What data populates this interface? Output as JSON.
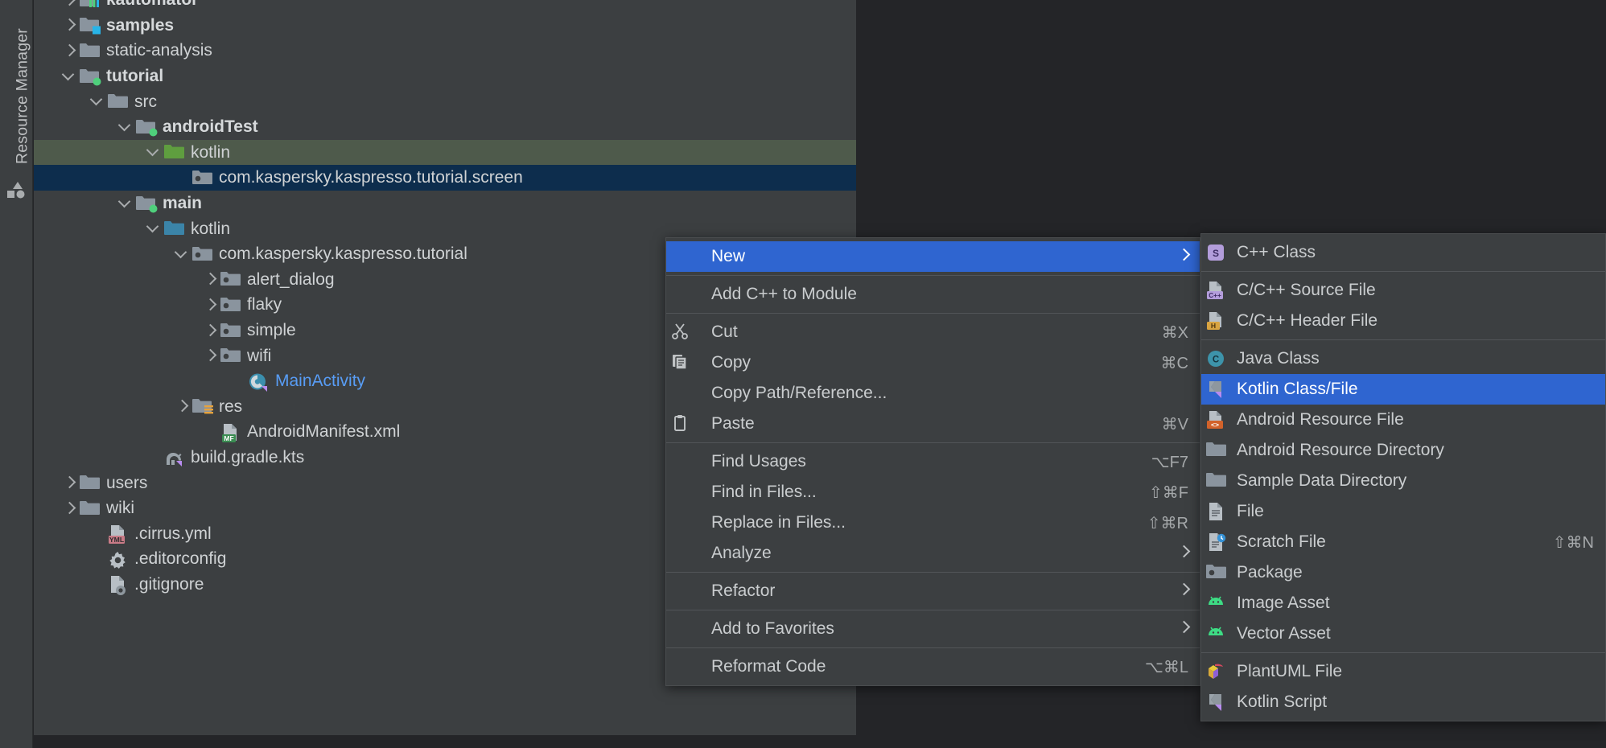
{
  "toolwindow": {
    "label": "Resource Manager",
    "icon": "shapes-icon"
  },
  "project_tree": {
    "rows": [
      {
        "label": "kautomator",
        "indent": 55,
        "arrow": "closed",
        "icon": "module-chart-folder-icon",
        "bold": true,
        "state": "normal",
        "partial_top": true
      },
      {
        "label": "samples",
        "indent": 55,
        "arrow": "closed",
        "icon": "folder-source-blue-icon",
        "bold": true,
        "state": "normal"
      },
      {
        "label": "static-analysis",
        "indent": 55,
        "arrow": "closed",
        "icon": "folder-icon",
        "bold": false,
        "state": "normal"
      },
      {
        "label": "tutorial",
        "indent": 55,
        "arrow": "open",
        "icon": "folder-module-green-icon",
        "bold": true,
        "state": "normal"
      },
      {
        "label": "src",
        "indent": 90,
        "arrow": "open",
        "icon": "folder-icon",
        "bold": false,
        "state": "normal"
      },
      {
        "label": "androidTest",
        "indent": 125,
        "arrow": "open",
        "icon": "folder-module-green-icon",
        "bold": true,
        "state": "normal"
      },
      {
        "label": "kotlin",
        "indent": 160,
        "arrow": "open",
        "icon": "folder-green-icon",
        "bold": false,
        "state": "selected-parent"
      },
      {
        "label": "com.kaspersky.kaspresso.tutorial.screen",
        "indent": 195,
        "arrow": "none",
        "icon": "package-icon",
        "bold": false,
        "state": "selected"
      },
      {
        "label": "main",
        "indent": 125,
        "arrow": "open",
        "icon": "folder-module-green-icon",
        "bold": true,
        "state": "normal"
      },
      {
        "label": "kotlin",
        "indent": 160,
        "arrow": "open",
        "icon": "folder-blue-icon",
        "bold": false,
        "state": "normal"
      },
      {
        "label": "com.kaspersky.kaspresso.tutorial",
        "indent": 195,
        "arrow": "open",
        "icon": "package-icon",
        "bold": false,
        "state": "normal"
      },
      {
        "label": "alert_dialog",
        "indent": 230,
        "arrow": "closed",
        "icon": "package-icon",
        "bold": false,
        "state": "normal"
      },
      {
        "label": "flaky",
        "indent": 230,
        "arrow": "closed",
        "icon": "package-icon",
        "bold": false,
        "state": "normal"
      },
      {
        "label": "simple",
        "indent": 230,
        "arrow": "closed",
        "icon": "package-icon",
        "bold": false,
        "state": "normal"
      },
      {
        "label": "wifi",
        "indent": 230,
        "arrow": "closed",
        "icon": "package-icon",
        "bold": false,
        "state": "normal"
      },
      {
        "label": "MainActivity",
        "indent": 265,
        "arrow": "none",
        "icon": "kotlin-activity-icon",
        "bold": false,
        "state": "normal",
        "blue": true
      },
      {
        "label": "res",
        "indent": 195,
        "arrow": "closed",
        "icon": "folder-res-icon",
        "bold": false,
        "state": "normal"
      },
      {
        "label": "AndroidManifest.xml",
        "indent": 230,
        "arrow": "none",
        "icon": "manifest-file-icon",
        "bold": false,
        "state": "normal"
      },
      {
        "label": "build.gradle.kts",
        "indent": 160,
        "arrow": "none",
        "icon": "gradle-kts-icon",
        "bold": false,
        "state": "normal"
      },
      {
        "label": "users",
        "indent": 55,
        "arrow": "closed",
        "icon": "folder-icon",
        "bold": false,
        "state": "normal"
      },
      {
        "label": "wiki",
        "indent": 55,
        "arrow": "closed",
        "icon": "folder-icon",
        "bold": false,
        "state": "normal"
      },
      {
        "label": ".cirrus.yml",
        "indent": 90,
        "arrow": "none",
        "icon": "yml-file-icon",
        "bold": false,
        "state": "normal"
      },
      {
        "label": ".editorconfig",
        "indent": 90,
        "arrow": "none",
        "icon": "gear-icon",
        "bold": false,
        "state": "normal"
      },
      {
        "label": ".gitignore",
        "indent": 90,
        "arrow": "none",
        "icon": "git-file-icon",
        "bold": false,
        "state": "normal"
      }
    ]
  },
  "context_menu": {
    "items": [
      {
        "label": "New",
        "icon": "none",
        "shortcut": "",
        "submenu": true,
        "highlight": true
      },
      {
        "separator": true
      },
      {
        "label": "Add C++ to Module",
        "icon": "none",
        "shortcut": "",
        "submenu": false,
        "highlight": false
      },
      {
        "separator": true
      },
      {
        "label": "Cut",
        "icon": "scissors-icon",
        "shortcut": "⌘X",
        "submenu": false,
        "highlight": false
      },
      {
        "label": "Copy",
        "icon": "copy-icon",
        "shortcut": "⌘C",
        "submenu": false,
        "highlight": false
      },
      {
        "label": "Copy Path/Reference...",
        "icon": "none",
        "shortcut": "",
        "submenu": false,
        "highlight": false
      },
      {
        "label": "Paste",
        "icon": "clipboard-icon",
        "shortcut": "⌘V",
        "submenu": false,
        "highlight": false
      },
      {
        "separator": true
      },
      {
        "label": "Find Usages",
        "icon": "none",
        "shortcut": "⌥F7",
        "submenu": false,
        "highlight": false
      },
      {
        "label": "Find in Files...",
        "icon": "none",
        "shortcut": "⇧⌘F",
        "submenu": false,
        "highlight": false
      },
      {
        "label": "Replace in Files...",
        "icon": "none",
        "shortcut": "⇧⌘R",
        "submenu": false,
        "highlight": false
      },
      {
        "label": "Analyze",
        "icon": "none",
        "shortcut": "",
        "submenu": true,
        "highlight": false
      },
      {
        "separator": true
      },
      {
        "label": "Refactor",
        "icon": "none",
        "shortcut": "",
        "submenu": true,
        "highlight": false
      },
      {
        "separator": true
      },
      {
        "label": "Add to Favorites",
        "icon": "none",
        "shortcut": "",
        "submenu": true,
        "highlight": false
      },
      {
        "separator": true
      },
      {
        "label": "Reformat Code",
        "icon": "none",
        "shortcut": "⌥⌘L",
        "submenu": false,
        "highlight": false
      }
    ]
  },
  "new_submenu": {
    "items": [
      {
        "label": "C++ Class",
        "icon": "cpp-class-icon",
        "shortcut": "",
        "highlight": false
      },
      {
        "separator": true
      },
      {
        "label": "C/C++ Source File",
        "icon": "cpp-source-file-icon",
        "shortcut": "",
        "highlight": false
      },
      {
        "label": "C/C++ Header File",
        "icon": "cpp-header-file-icon",
        "shortcut": "",
        "highlight": false
      },
      {
        "separator": true
      },
      {
        "label": "Java Class",
        "icon": "java-class-icon",
        "shortcut": "",
        "highlight": false
      },
      {
        "label": "Kotlin Class/File",
        "icon": "kotlin-file-icon",
        "shortcut": "",
        "highlight": true
      },
      {
        "label": "Android Resource File",
        "icon": "android-res-file-icon",
        "shortcut": "",
        "highlight": false
      },
      {
        "label": "Android Resource Directory",
        "icon": "folder-icon",
        "shortcut": "",
        "highlight": false
      },
      {
        "label": "Sample Data Directory",
        "icon": "folder-icon",
        "shortcut": "",
        "highlight": false
      },
      {
        "label": "File",
        "icon": "file-icon",
        "shortcut": "",
        "highlight": false
      },
      {
        "label": "Scratch File",
        "icon": "scratch-file-icon",
        "shortcut": "⇧⌘N",
        "highlight": false
      },
      {
        "label": "Package",
        "icon": "package-icon",
        "shortcut": "",
        "highlight": false
      },
      {
        "label": "Image Asset",
        "icon": "android-robot-icon",
        "shortcut": "",
        "highlight": false
      },
      {
        "label": "Vector Asset",
        "icon": "android-robot-icon",
        "shortcut": "",
        "highlight": false
      },
      {
        "separator": true
      },
      {
        "label": "PlantUML File",
        "icon": "plantuml-icon",
        "shortcut": "",
        "highlight": false
      },
      {
        "label": "Kotlin Script",
        "icon": "kotlin-script-icon",
        "shortcut": "",
        "highlight": false
      }
    ]
  },
  "colors": {
    "panel_bg": "#3c3f41",
    "app_bg": "#242528",
    "selection_blue": "#2f65d0",
    "tree_selection": "#0d2d4d",
    "tree_parent_selection": "#4e5a4b",
    "text": "#cacdcf",
    "link_blue": "#589df6",
    "folder_gray": "#8a949e",
    "kotlin_green": "#55a352"
  }
}
